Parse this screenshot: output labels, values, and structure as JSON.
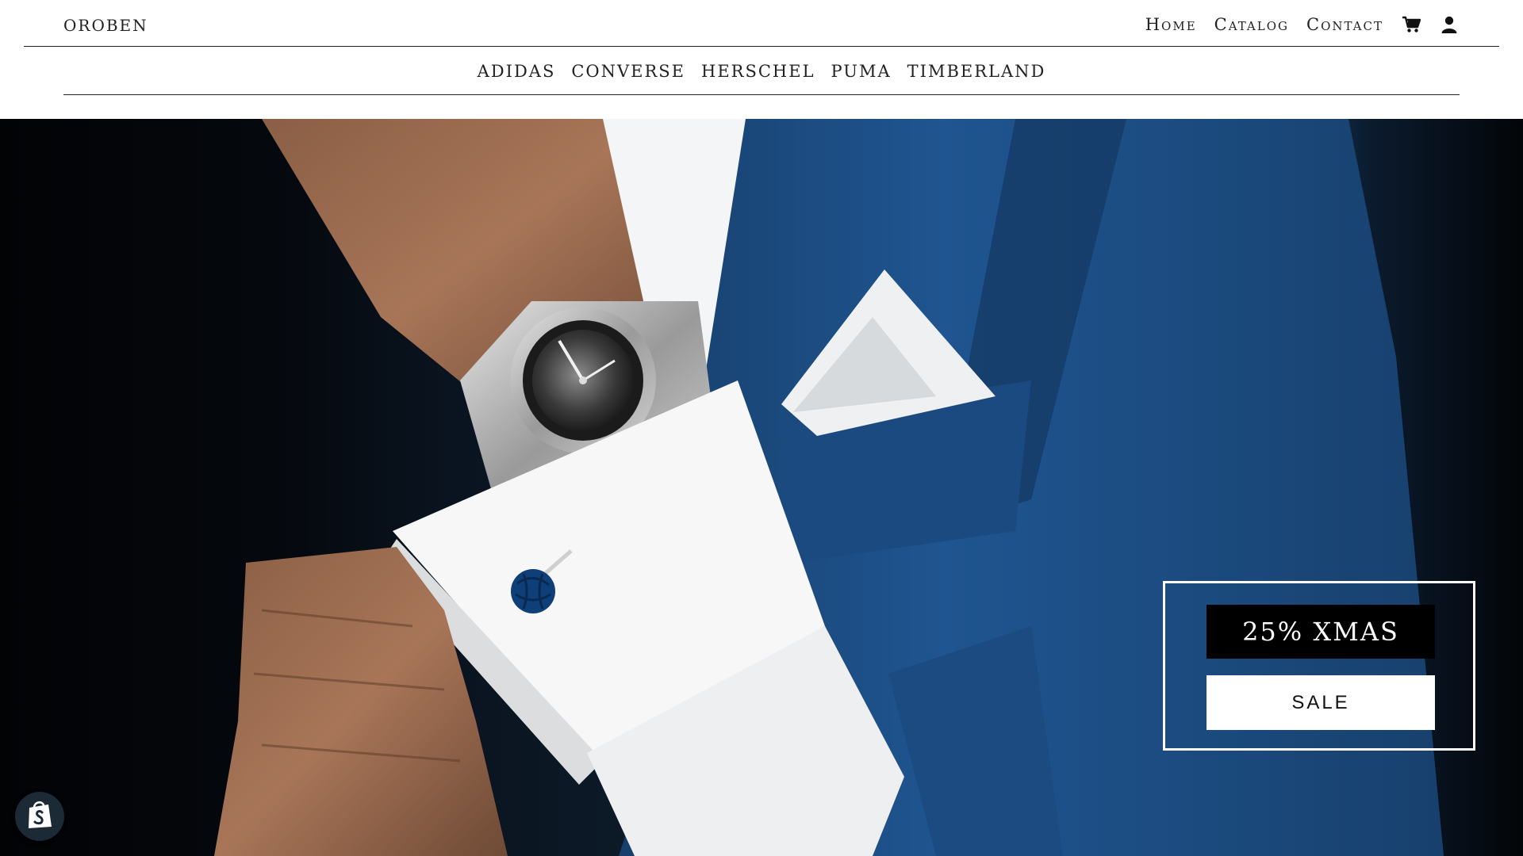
{
  "header": {
    "brand": "OROBEN",
    "nav": {
      "home": "Home",
      "catalog": "Catalog",
      "contact": "Contact"
    },
    "icons": [
      "cart-icon",
      "account-icon"
    ]
  },
  "brands_nav": [
    "ADIDAS",
    "CONVERSE",
    "HERSCHEL",
    "PUMA",
    "TIMBERLAND"
  ],
  "hero": {
    "image": "man adjusting white shirt cuff with wristwatch and blue knot cufflink, blue suit jacket with pocket square",
    "promo_title": "25% XMAS",
    "promo_button": "SALE"
  },
  "floating": {
    "icon": "shopify-bag-icon"
  },
  "colors": {
    "header_bg": "#ffffff",
    "text": "#222222",
    "suit_blue": "#1d4d82",
    "promo_dark": "#000000"
  }
}
